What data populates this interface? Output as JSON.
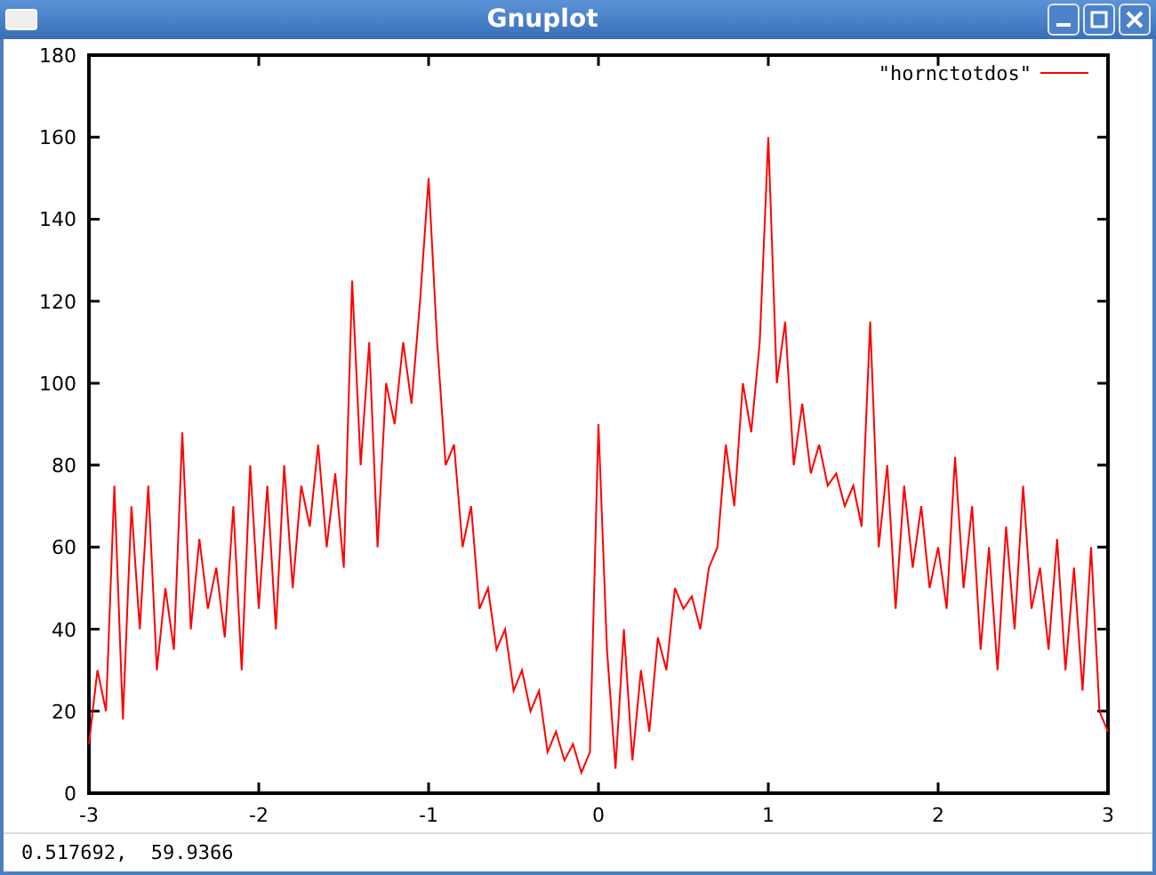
{
  "window": {
    "title": "Gnuplot"
  },
  "plot": {
    "chart_data": {
      "type": "line",
      "x": [
        -3,
        -2.95,
        -2.9,
        -2.85,
        -2.8,
        -2.75,
        -2.7,
        -2.65,
        -2.6,
        -2.55,
        -2.5,
        -2.45,
        -2.4,
        -2.35,
        -2.3,
        -2.25,
        -2.2,
        -2.15,
        -2.1,
        -2.05,
        -2,
        -1.95,
        -1.9,
        -1.85,
        -1.8,
        -1.75,
        -1.7,
        -1.65,
        -1.6,
        -1.55,
        -1.5,
        -1.45,
        -1.4,
        -1.35,
        -1.3,
        -1.25,
        -1.2,
        -1.15,
        -1.1,
        -1.05,
        -1,
        -0.95,
        -0.9,
        -0.85,
        -0.8,
        -0.75,
        -0.7,
        -0.65,
        -0.6,
        -0.55,
        -0.5,
        -0.45,
        -0.4,
        -0.35,
        -0.3,
        -0.25,
        -0.2,
        -0.15,
        -0.1,
        -0.05,
        0,
        0.05,
        0.1,
        0.15,
        0.2,
        0.25,
        0.3,
        0.35,
        0.4,
        0.45,
        0.5,
        0.55,
        0.6,
        0.65,
        0.7,
        0.75,
        0.8,
        0.85,
        0.9,
        0.95,
        1,
        1.05,
        1.1,
        1.15,
        1.2,
        1.25,
        1.3,
        1.35,
        1.4,
        1.45,
        1.5,
        1.55,
        1.6,
        1.65,
        1.7,
        1.75,
        1.8,
        1.85,
        1.9,
        1.95,
        2,
        2.05,
        2.1,
        2.15,
        2.2,
        2.25,
        2.3,
        2.35,
        2.4,
        2.45,
        2.5,
        2.55,
        2.6,
        2.65,
        2.7,
        2.75,
        2.8,
        2.85,
        2.9,
        2.95,
        3
      ],
      "series": [
        {
          "name": "\"hornctotdos\"",
          "color": "#ff0000",
          "values": [
            12,
            30,
            20,
            75,
            18,
            70,
            40,
            75,
            30,
            50,
            35,
            88,
            40,
            62,
            45,
            55,
            38,
            70,
            30,
            80,
            45,
            75,
            40,
            80,
            50,
            75,
            65,
            85,
            60,
            78,
            55,
            125,
            80,
            110,
            60,
            100,
            90,
            110,
            95,
            120,
            150,
            110,
            80,
            85,
            60,
            70,
            45,
            50,
            35,
            40,
            25,
            30,
            20,
            25,
            10,
            15,
            8,
            12,
            5,
            10,
            90,
            35,
            6,
            40,
            8,
            30,
            15,
            38,
            30,
            50,
            45,
            48,
            40,
            55,
            60,
            85,
            70,
            100,
            88,
            110,
            160,
            100,
            115,
            80,
            95,
            78,
            85,
            75,
            78,
            70,
            75,
            65,
            115,
            60,
            80,
            45,
            75,
            55,
            70,
            50,
            60,
            45,
            82,
            50,
            70,
            35,
            60,
            30,
            65,
            40,
            75,
            45,
            55,
            35,
            62,
            30,
            55,
            25,
            60,
            20,
            15
          ]
        }
      ],
      "xlim": [
        -3,
        3
      ],
      "ylim": [
        0,
        180
      ],
      "xticks": [
        -3,
        -2,
        -1,
        0,
        1,
        2,
        3
      ],
      "yticks": [
        0,
        20,
        40,
        60,
        80,
        100,
        120,
        140,
        160,
        180
      ]
    }
  },
  "status_bar": {
    "text": "0.517692,  59.9366"
  }
}
